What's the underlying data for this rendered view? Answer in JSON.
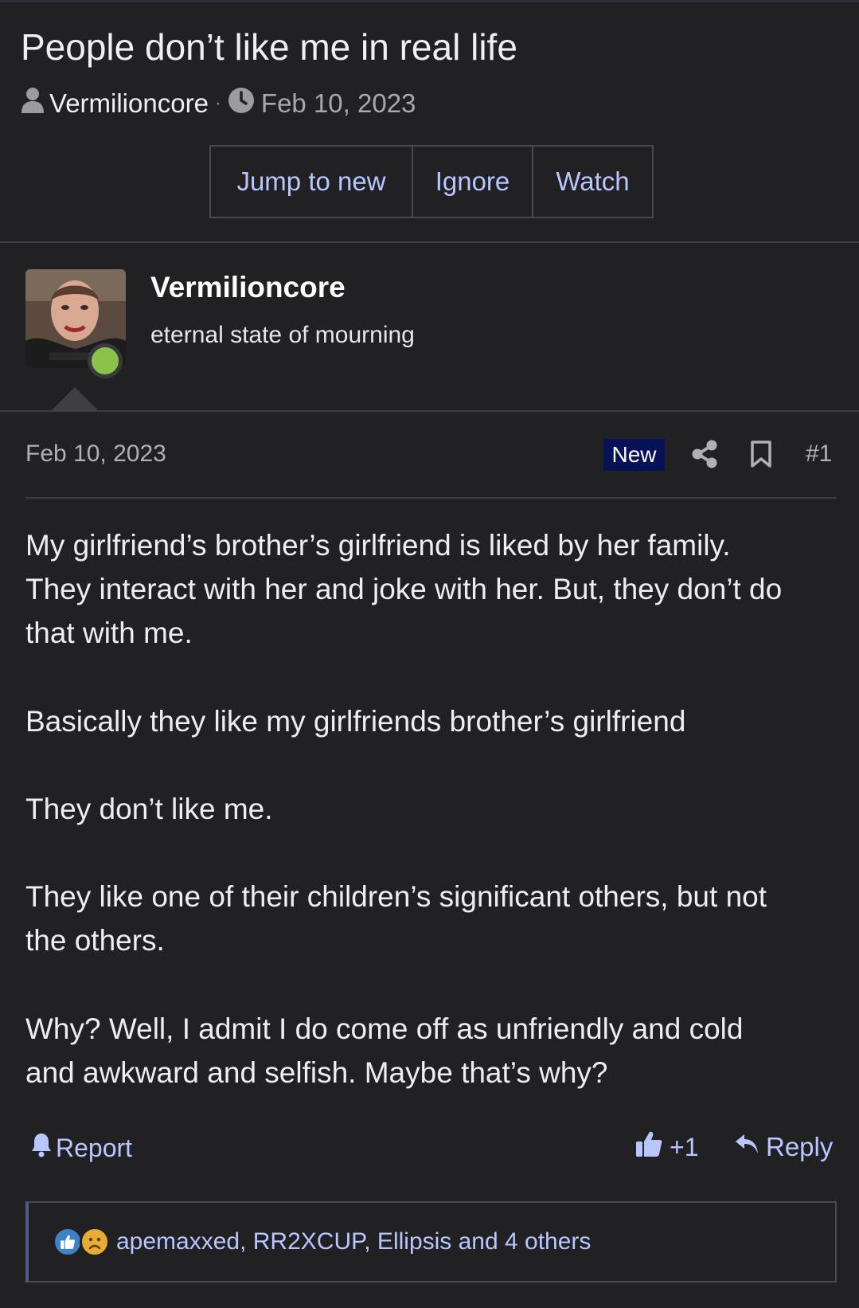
{
  "thread": {
    "title": "People don’t like me in real life",
    "author": "Vermilioncore",
    "separator": "·",
    "date": "Feb 10, 2023"
  },
  "actions": {
    "jump_to_new": "Jump to new",
    "ignore": "Ignore",
    "watch": "Watch"
  },
  "post": {
    "username": "Vermilioncore",
    "user_title": "eternal state of mourning",
    "date": "Feb 10, 2023",
    "badge": "New",
    "number": "#1",
    "paragraphs": [
      [
        "My girlfriend’s brother’s girlfriend is liked by her family.",
        "They interact with her and joke with her. But, they don’t do",
        "that with me."
      ],
      [
        "Basically they like my girlfriends brother’s girlfriend"
      ],
      [
        "They don’t like me."
      ],
      [
        "They like one of their children’s significant others, but not",
        "the others."
      ],
      [
        "Why? Well, I admit I do come off as unfriendly and cold",
        "and awkward and selfish. Maybe that’s why?"
      ]
    ],
    "report_label": "Report",
    "like_count": "+1",
    "reply_label": "Reply",
    "reactions_text": "apemaxxed, RR2XCUP, Ellipsis and 4 others"
  },
  "colors": {
    "background": "#212123",
    "link": "#b8c6ff",
    "new_badge": "#061158",
    "online": "#8bc34a"
  },
  "icons": {
    "author": "user-icon",
    "date": "clock-icon",
    "share": "share-icon",
    "bookmark": "bookmark-icon",
    "report": "bell-icon",
    "like": "thumbs-up-icon",
    "reply": "reply-icon",
    "reaction_like": "like-reaction-icon",
    "reaction_sad": "sad-reaction-icon"
  }
}
